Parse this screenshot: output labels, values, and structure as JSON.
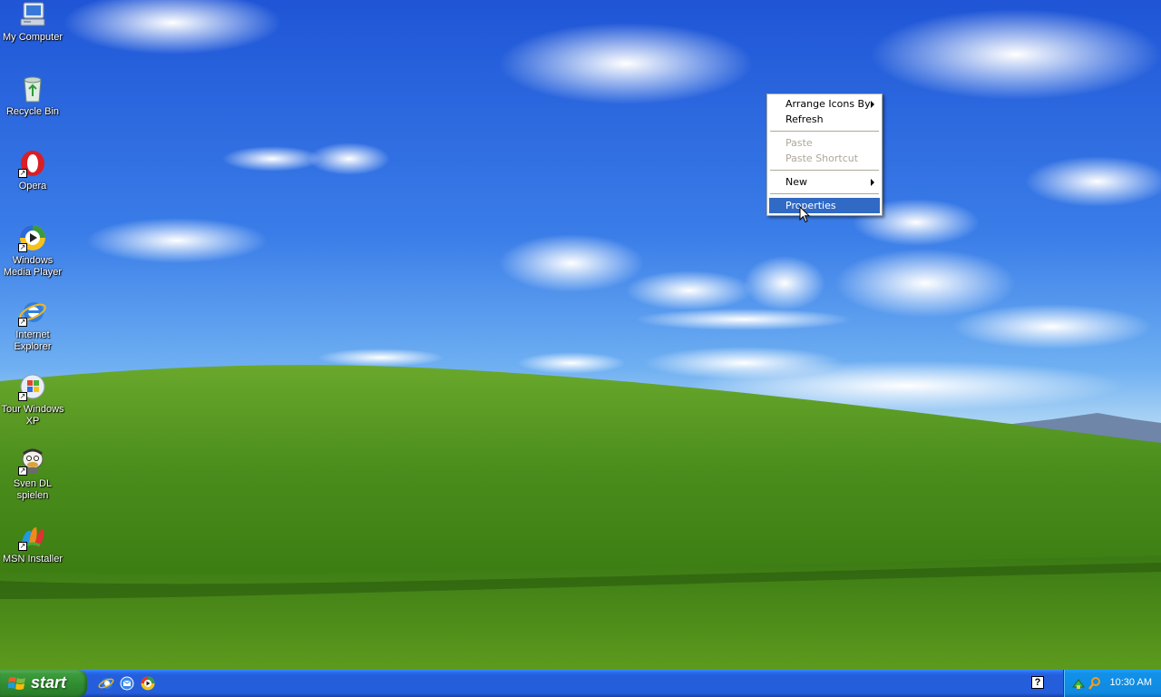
{
  "desktop": {
    "icons": [
      {
        "name": "my-computer-icon",
        "label": "My Computer"
      },
      {
        "name": "recycle-bin-icon",
        "label": "Recycle Bin"
      },
      {
        "name": "opera-icon",
        "label": "Opera"
      },
      {
        "name": "windows-media-player-icon",
        "label": "Windows Media Player"
      },
      {
        "name": "internet-explorer-icon",
        "label": "Internet Explorer"
      },
      {
        "name": "tour-windows-xp-icon",
        "label": "Tour Windows XP"
      },
      {
        "name": "sven-dl-spielen-icon",
        "label": "Sven DL spielen"
      },
      {
        "name": "msn-installer-icon",
        "label": "MSN Installer"
      }
    ]
  },
  "context_menu": {
    "items": {
      "arrange_icons_by": "Arrange Icons By",
      "refresh": "Refresh",
      "paste": "Paste",
      "paste_shortcut": "Paste Shortcut",
      "new": "New",
      "properties": "Properties"
    },
    "selected": "Properties"
  },
  "taskbar": {
    "start_label": "start",
    "quick_launch": [
      "internet-explorer-icon",
      "outlook-express-icon",
      "media-player-icon"
    ],
    "help_glyph": "?",
    "clock": "10:30 AM"
  },
  "colors": {
    "menu_highlight": "#316ac5",
    "taskbar": "#245edb",
    "start_green": "#3c9c3c",
    "tray": "#0f8ae0"
  }
}
